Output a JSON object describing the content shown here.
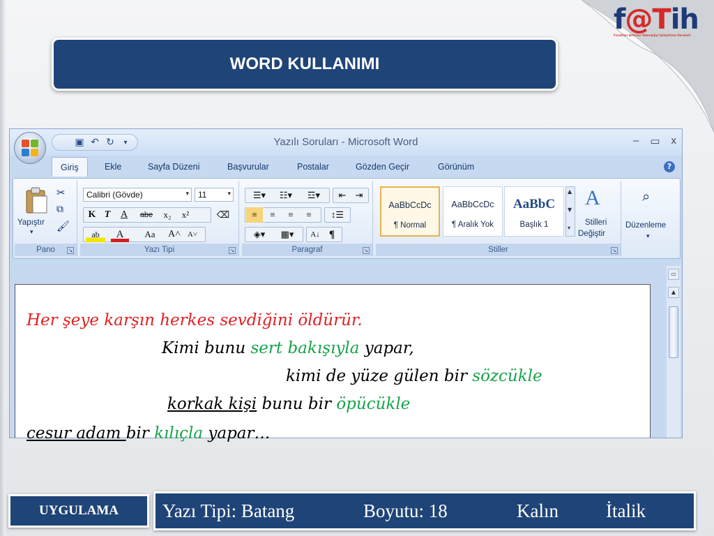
{
  "slide": {
    "title": "WORD KULLANIMI",
    "logo_text_a": "f",
    "logo_text_b": "@",
    "logo_text_c": "T",
    "logo_text_d": "ih",
    "logo_sub": "Fırsatları Artırma Teknolojiyi İyileştirme Hareketi"
  },
  "word": {
    "window_title": "Yazılı Soruları - Microsoft Word",
    "window_controls": [
      "–",
      "▭",
      "x"
    ],
    "tabs": [
      "Giriş",
      "Ekle",
      "Sayfa Düzeni",
      "Başvurular",
      "Postalar",
      "Gözden Geçir",
      "Görünüm"
    ],
    "help": "?",
    "ribbon": {
      "pano": {
        "label": "Pano",
        "paste": "Yapıştır"
      },
      "font": {
        "label": "Yazı Tipi",
        "font_name": "Calibri (Gövde)",
        "font_size": "11"
      },
      "paragraph": {
        "label": "Paragraf"
      },
      "styles": {
        "label": "Stiller",
        "items": [
          {
            "sample": "AaBbCcDc",
            "name": "¶ Normal"
          },
          {
            "sample": "AaBbCcDc",
            "name": "¶ Aralık Yok"
          },
          {
            "sample": "AaBbC",
            "name": "Başlık 1"
          }
        ],
        "change_1": "Stilleri",
        "change_2": "Değiştir"
      },
      "edit": {
        "label": "Düzenleme"
      }
    }
  },
  "poem": {
    "l1": "Her şeye karşın herkes sevdiğini öldürür.",
    "l2a": "Kimi bunu ",
    "l2b": "sert bakışıyla",
    "l2c": " yapar,",
    "l3a": "kimi de yüze gülen bir ",
    "l3b": "sözcükle",
    "l4a": "korkak kişi",
    "l4b": " bunu bir ",
    "l4c": "öpücükle",
    "l5a": "cesur adam ",
    "l5b": "bir ",
    "l5c": "kılıçla",
    "l5d": " yapar…"
  },
  "footer": {
    "label": "UYGULAMA",
    "font": "Yazı Tipi: Batang",
    "size": "Boyutu: 18",
    "bold": "Kalın",
    "italic": "İtalik"
  },
  "colors": {
    "navy": "#1f4478",
    "red": "#e02020",
    "green": "#16a34a"
  }
}
